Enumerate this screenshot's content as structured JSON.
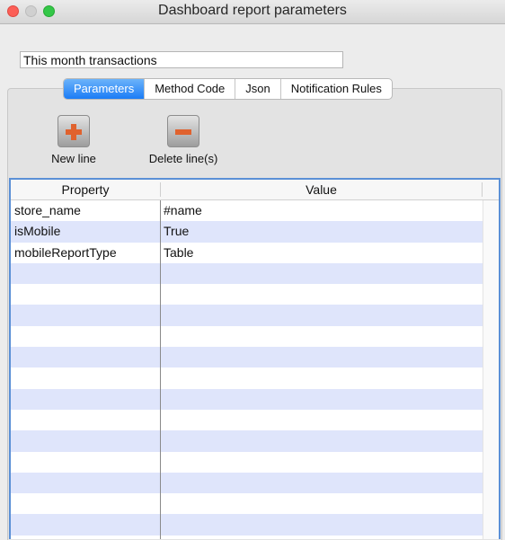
{
  "window": {
    "title": "Dashboard report parameters"
  },
  "report_name": {
    "value": "This month transactions"
  },
  "tabs": [
    {
      "label": "Parameters",
      "active": true
    },
    {
      "label": "Method Code",
      "active": false
    },
    {
      "label": "Json",
      "active": false
    },
    {
      "label": "Notification Rules",
      "active": false
    }
  ],
  "toolbar": {
    "new_line_label": "New line",
    "new_line_icon": "plus-icon",
    "delete_lines_label": "Delete line(s)",
    "delete_lines_icon": "minus-icon",
    "icon_color": "#e0622e"
  },
  "table": {
    "columns": [
      "Property",
      "Value"
    ],
    "rows": [
      {
        "property": "store_name",
        "value": "#name"
      },
      {
        "property": "isMobile",
        "value": "True"
      },
      {
        "property": "mobileReportType",
        "value": "Table"
      },
      {
        "property": "",
        "value": ""
      },
      {
        "property": "",
        "value": ""
      },
      {
        "property": "",
        "value": ""
      },
      {
        "property": "",
        "value": ""
      },
      {
        "property": "",
        "value": ""
      },
      {
        "property": "",
        "value": ""
      },
      {
        "property": "",
        "value": ""
      },
      {
        "property": "",
        "value": ""
      },
      {
        "property": "",
        "value": ""
      },
      {
        "property": "",
        "value": ""
      },
      {
        "property": "",
        "value": ""
      },
      {
        "property": "",
        "value": ""
      },
      {
        "property": "",
        "value": ""
      },
      {
        "property": "",
        "value": ""
      }
    ],
    "stripe_color": "#dfe5fb",
    "focus_color": "#5b90d6"
  },
  "colors": {
    "close": "#fc5f57",
    "minimize_inactive": "#d0d0d0",
    "maximize": "#34c748",
    "active_tab": "#1b7cf6"
  }
}
